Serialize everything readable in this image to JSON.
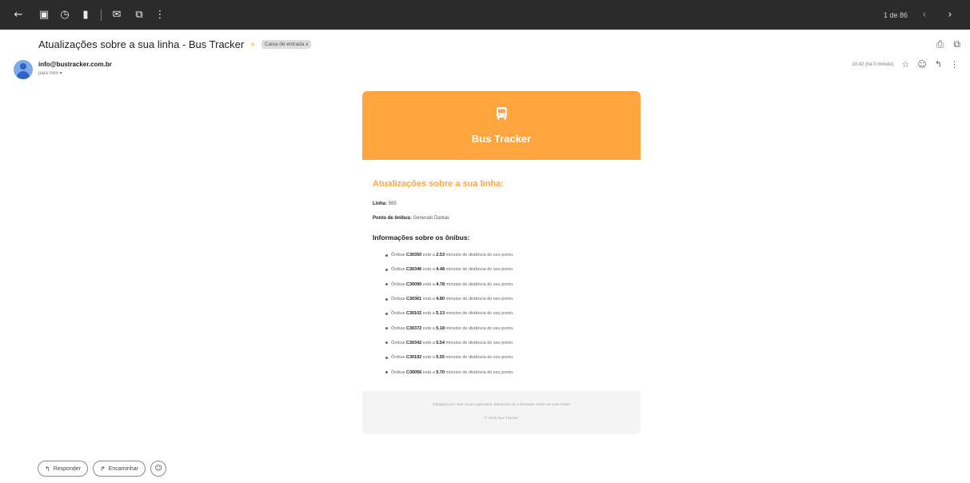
{
  "toolbar": {
    "icons": [
      "back-arrow-icon",
      "archive-icon",
      "clock-icon",
      "trash-icon",
      "mark-unread-icon",
      "move-to-icon",
      "more-vert-icon"
    ],
    "count_label": "1 de 86"
  },
  "subject": {
    "title": "Atualizações sobre a sua linha - Bus Tracker",
    "label": "Caixa de entrada x"
  },
  "sender": {
    "email": "info@bustracker.com.br",
    "to": "para mim"
  },
  "message_meta": {
    "time": "10:42 (há 0 minuto)"
  },
  "email": {
    "header_title": "Bus Tracker",
    "updates_title": "Atualizações sobre a sua linha:",
    "linha_label": "Linha:",
    "linha_value": "565",
    "ponto_label": "Ponto de ônibus:",
    "ponto_value": "Generalo Dantas",
    "bus_info_title": "Informações sobre os ônibus:",
    "buses": [
      {
        "prefix": "Ônibus",
        "id": "C30350",
        "mid": "está a",
        "minutes": "2.53",
        "suffix": "minutos de distância do seu ponto."
      },
      {
        "prefix": "Ônibus",
        "id": "C30346",
        "mid": "está a",
        "minutes": "4.48",
        "suffix": "minutos de distância do seu ponto."
      },
      {
        "prefix": "Ônibus",
        "id": "C30090",
        "mid": "está a",
        "minutes": "4.78",
        "suffix": "minutos de distância do seu ponto."
      },
      {
        "prefix": "Ônibus",
        "id": "C30361",
        "mid": "está a",
        "minutes": "4.80",
        "suffix": "minutos de distância do seu ponto."
      },
      {
        "prefix": "Ônibus",
        "id": "C30102",
        "mid": "está a",
        "minutes": "5.13",
        "suffix": "minutos de distância do seu ponto."
      },
      {
        "prefix": "Ônibus",
        "id": "C30372",
        "mid": "está a",
        "minutes": "5.18",
        "suffix": "minutos de distância do seu ponto."
      },
      {
        "prefix": "Ônibus",
        "id": "C30342",
        "mid": "está a",
        "minutes": "5.54",
        "suffix": "minutos de distância do seu ponto."
      },
      {
        "prefix": "Ônibus",
        "id": "C30192",
        "mid": "está a",
        "minutes": "5.55",
        "suffix": "minutos de distância do seu ponto."
      },
      {
        "prefix": "Ônibus",
        "id": "C30056",
        "mid": "está a",
        "minutes": "5.70",
        "suffix": "minutos de distância do seu ponto."
      }
    ],
    "footer_text": "Obrigado por usar nosso aplicativo. Mantenha-se informado sobre as suas rotas!",
    "footer_copy": "© 2025 Bus Tracker"
  },
  "reply": {
    "reply_label": "Responder",
    "forward_label": "Encaminhar"
  },
  "colors": {
    "brand_orange": "#ffa53f",
    "toolbar_bg": "#2b2b2b"
  }
}
